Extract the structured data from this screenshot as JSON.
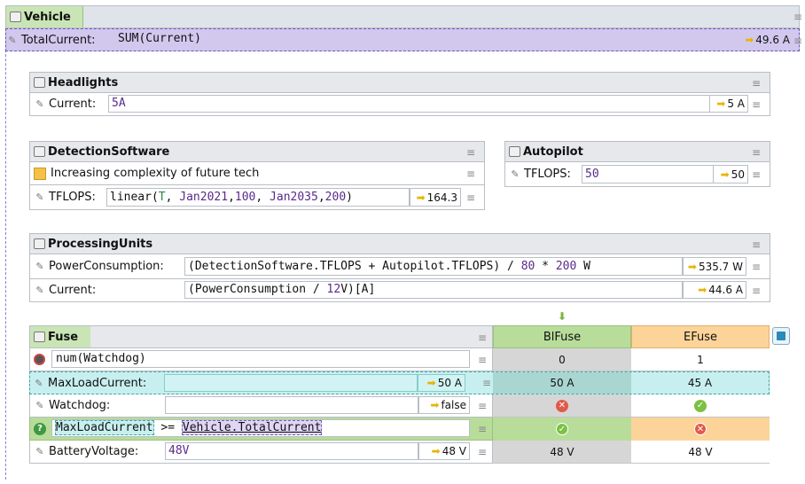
{
  "vehicle": {
    "title": "Vehicle",
    "field_label": "TotalCurrent:",
    "formula": "SUM(Current)",
    "result": "49.6 A"
  },
  "headlights": {
    "title": "Headlights",
    "field_label": "Current:",
    "value": "5A",
    "result": "5 A"
  },
  "detection": {
    "title": "DetectionSoftware",
    "note": "Increasing complexity of future tech",
    "field_label": "TFLOPS:",
    "formula_parts": [
      "linear(",
      "T",
      ", ",
      "Jan2021",
      ",",
      "100",
      ", ",
      "Jan2035",
      ",",
      "200",
      ")"
    ],
    "result": "164.3"
  },
  "autopilot": {
    "title": "Autopilot",
    "field_label": "TFLOPS:",
    "value": "50",
    "result": "50"
  },
  "processing": {
    "title": "ProcessingUnits",
    "pc_label": "PowerConsumption:",
    "pc_formula_a": "(DetectionSoftware.TFLOPS + Autopilot.TFLOPS) / ",
    "pc_num1": "80",
    "pc_op": " * ",
    "pc_num2": "200",
    "pc_unit": " W",
    "pc_result": "535.7 W",
    "cur_label": "Current:",
    "cur_formula_a": "(PowerConsumption / ",
    "cur_num": "12",
    "cur_formula_b": "V)[A]",
    "cur_result": "44.6 A"
  },
  "fuse": {
    "title": "Fuse",
    "col1": "BlFuse",
    "col2": "EFuse",
    "row_num_label": "num(Watchdog)",
    "num_bl": "0",
    "num_e": "1",
    "mlc_label": "MaxLoadCurrent:",
    "mlc_result": "50 A",
    "mlc_bl": "50 A",
    "mlc_e": "45 A",
    "wd_label": "Watchdog:",
    "wd_result": "false",
    "cond_left": "MaxLoadCurrent",
    "cond_op": ">=",
    "cond_right": "Vehicle.TotalCurrent",
    "bv_label": "BatteryVoltage:",
    "bv_value": "48V",
    "bv_result": "48 V",
    "bv_bl": "48 V",
    "bv_e": "48 V"
  },
  "menu_glyph": "≡",
  "colors": {
    "accent_green": "#b8dc9a",
    "accent_orange": "#fcd49a",
    "vehicle_bar": "#d2c8ee",
    "highlight_teal": "#c8efef"
  }
}
